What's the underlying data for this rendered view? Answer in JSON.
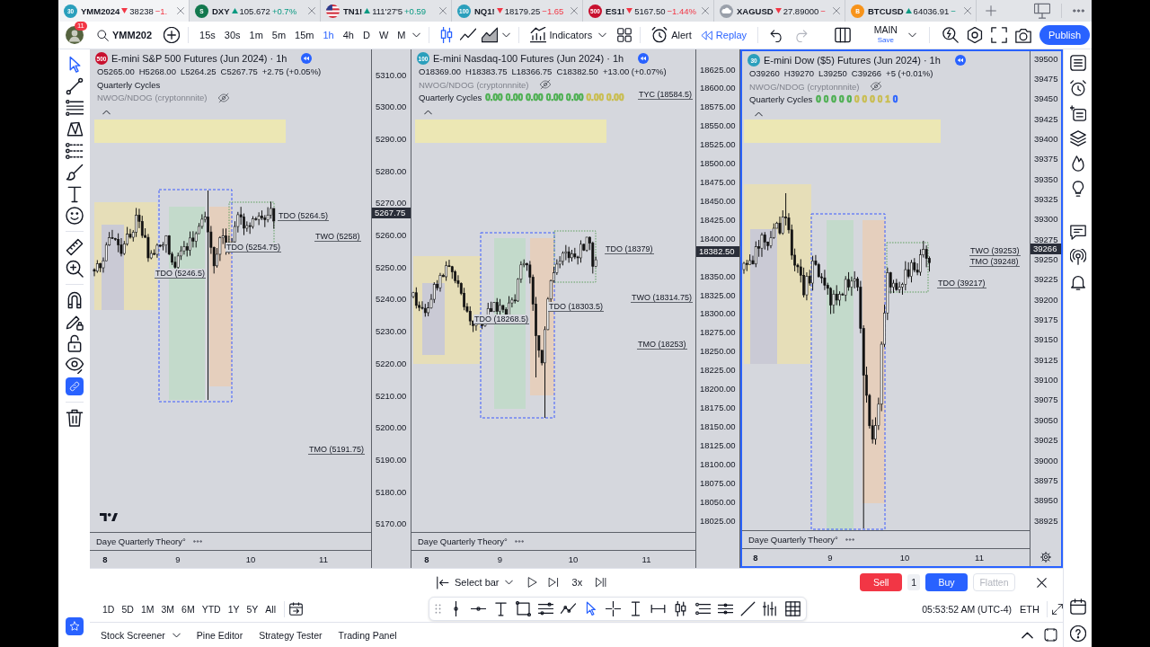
{
  "tabs": [
    {
      "kind": "badge",
      "badge": "30",
      "color": "#2a9fbc",
      "symbol": "YMM2024",
      "rising": false,
      "price": "38238",
      "change": "−1.",
      "selected": true
    },
    {
      "kind": "badge",
      "badge": "S",
      "color": "#12774d",
      "symbol": "DXY",
      "rising": true,
      "price": "105.672",
      "change": "+0.7%",
      "selected": false
    },
    {
      "kind": "flag",
      "symbol": "TN1!",
      "rising": true,
      "price": "111'27'5",
      "change": "+0.59",
      "selected": false
    },
    {
      "kind": "badge",
      "badge": "100",
      "color": "#2a9fbc",
      "symbol": "NQ1!",
      "rising": false,
      "price": "18179.25",
      "change": "−1.65",
      "selected": false
    },
    {
      "kind": "badge",
      "badge": "500",
      "color": "#c8102e",
      "symbol": "ES1!",
      "rising": false,
      "price": "5167.50",
      "change": "−1.44%",
      "selected": false
    },
    {
      "kind": "cloud",
      "symbol": "XAGUSD",
      "rising": false,
      "price": "27.89000",
      "change": "−",
      "selected": false
    },
    {
      "kind": "badge",
      "badge": "B",
      "color": "#f7931a",
      "symbol": "BTCUSD",
      "rising": true,
      "price": "64036.91",
      "change": "−",
      "selected": false
    }
  ],
  "user": {
    "notifications": "11"
  },
  "symbol_search": "YMM202",
  "intervals": [
    {
      "label": "15s",
      "selected": false
    },
    {
      "label": "30s",
      "selected": false
    },
    {
      "label": "1m",
      "selected": false
    },
    {
      "label": "5m",
      "selected": false
    },
    {
      "label": "15m",
      "selected": false
    },
    {
      "label": "1h",
      "selected": true
    },
    {
      "label": "4h",
      "selected": false
    },
    {
      "label": "D",
      "selected": false
    },
    {
      "label": "W",
      "selected": false
    },
    {
      "label": "M",
      "selected": false
    }
  ],
  "chart_types": [
    {
      "kind": "candles",
      "selected": true
    },
    {
      "kind": "line",
      "selected": false
    },
    {
      "kind": "area",
      "selected": false
    }
  ],
  "indicators_button": "Indicators",
  "alert_button": "Alert",
  "replay_button": "Replay",
  "history": [
    {
      "kind": "undo",
      "disabled": false
    },
    {
      "kind": "redo",
      "disabled": true
    }
  ],
  "layout": {
    "name": "MAIN",
    "status": "Save"
  },
  "publish_button": "Publish",
  "left_toolbar": [
    [
      {
        "kind": "cursor",
        "selected": true,
        "on": false
      },
      {
        "kind": "trendline",
        "selected": false,
        "on": false
      },
      {
        "kind": "fib",
        "selected": false,
        "on": false
      },
      {
        "kind": "pattern",
        "selected": false,
        "on": false
      },
      {
        "kind": "projection",
        "selected": false,
        "on": false
      },
      {
        "kind": "brush",
        "selected": false,
        "on": false
      },
      {
        "kind": "text",
        "selected": false,
        "on": false
      },
      {
        "kind": "emoji",
        "selected": false,
        "on": false
      }
    ],
    [
      {
        "kind": "ruler",
        "selected": false,
        "on": false
      },
      {
        "kind": "zoom",
        "selected": false,
        "on": false
      }
    ],
    [
      {
        "kind": "magnet",
        "selected": false,
        "on": false
      },
      {
        "kind": "pencillock",
        "selected": false,
        "on": false
      },
      {
        "kind": "lock",
        "selected": false,
        "on": false
      },
      {
        "kind": "eye",
        "selected": false,
        "on": false
      },
      {
        "kind": "link",
        "selected": false,
        "on": true
      }
    ],
    [
      {
        "kind": "trash",
        "selected": false,
        "on": false
      }
    ]
  ],
  "favorites": {
    "on": true
  },
  "panels": [
    {
      "badge": "500",
      "color": "#c8102e",
      "title": "E-mini S&P 500 Futures (Jun 2024) · 1h",
      "selected": false,
      "ohlc": {
        "open": "O5265.00",
        "high": "H5268.00",
        "low": "L5264.25",
        "close": "C5267.75",
        "change": "+2.75 (+0.05%)"
      },
      "studies": [
        {
          "name": "Quarterly Cycles",
          "hidden": false
        },
        {
          "name": "NWOG/NDOG (cryptonnnite)",
          "hidden": true
        }
      ],
      "labels": [
        "TDO (5264.5)",
        "TDO (5254.75)",
        "TWO (5258)",
        "TDO (5246.5)",
        "TMO (5191.75)"
      ],
      "logo": true,
      "price_axis": [
        "5310.00",
        "5300.00",
        "5290.00",
        "5280.00",
        "5270.00",
        "5260.00",
        "5250.00",
        "5240.00",
        "5230.00",
        "5220.00",
        "5210.00",
        "5200.00",
        "5190.00",
        "5180.00",
        "5170.00"
      ],
      "last_price": "5267.75",
      "pane": "Daye Quarterly Theory°",
      "time_axis": [
        "8",
        "9",
        "10",
        "11"
      ]
    },
    {
      "badge": "100",
      "color": "#2a9fbc",
      "title": "E-mini Nasdaq-100 Futures (Jun 2024) · 1h",
      "selected": false,
      "ohlc": {
        "open": "O18369.00",
        "high": "H18383.75",
        "low": "L18366.75",
        "close": "C18382.50",
        "change": "+13.00 (+0.07%)"
      },
      "studies": [
        {
          "name": "NWOG/NDOG (cryptonnnite)",
          "hidden": true
        },
        {
          "name": "Quarterly Cycles",
          "hidden": false,
          "values": [
            {
              "text": "0.00",
              "color": "#4caf50"
            },
            {
              "text": "0.00",
              "color": "#4caf50"
            },
            {
              "text": "0.00",
              "color": "#4caf50"
            },
            {
              "text": "0.00",
              "color": "#4caf50"
            },
            {
              "text": "0.00",
              "color": "#4caf50"
            },
            {
              "text": "0.00",
              "color": "#c9bd4f"
            },
            {
              "text": "0.00",
              "color": "#c9bd4f"
            }
          ]
        }
      ],
      "labels": [
        "TYC (18584.5)",
        "TDO (18379)",
        "TWO (18314.75)",
        "TDO (18303.5)",
        "TDO (18268.5)",
        "TMO (18253)"
      ],
      "logo": false,
      "price_axis": [
        "18625.00",
        "18600.00",
        "18575.00",
        "18550.00",
        "18525.00",
        "18500.00",
        "18475.00",
        "18450.00",
        "18425.00",
        "18400.00",
        "18350.00",
        "18325.00",
        "18300.00",
        "18275.00",
        "18250.00",
        "18225.00",
        "18200.00",
        "18175.00",
        "18150.00",
        "18125.00",
        "18100.00",
        "18075.00",
        "18050.00",
        "18025.00"
      ],
      "last_price": "18382.50",
      "pane": "Daye Quarterly Theory°",
      "time_axis": [
        "8",
        "9",
        "10",
        "11"
      ]
    },
    {
      "badge": "30",
      "color": "#2a9fbc",
      "title": "E-mini Dow ($5) Futures (Jun 2024) · 1h",
      "selected": true,
      "ohlc": {
        "open": "O39260",
        "high": "H39270",
        "low": "L39250",
        "close": "C39266",
        "change": "+5 (+0.01%)"
      },
      "studies": [
        {
          "name": "NWOG/NDOG (cryptonnnite)",
          "hidden": true
        },
        {
          "name": "Quarterly Cycles",
          "hidden": false,
          "values": [
            {
              "text": "0",
              "color": "#4caf50"
            },
            {
              "text": "0",
              "color": "#4caf50"
            },
            {
              "text": "0",
              "color": "#4caf50"
            },
            {
              "text": "0",
              "color": "#4caf50"
            },
            {
              "text": "0",
              "color": "#4caf50"
            },
            {
              "text": "0",
              "color": "#c9bd4f"
            },
            {
              "text": "0",
              "color": "#c9bd4f"
            },
            {
              "text": "0",
              "color": "#c9bd4f"
            },
            {
              "text": "0",
              "color": "#c9bd4f"
            },
            {
              "text": "1",
              "color": "#c9bd4f"
            },
            {
              "text": "0",
              "color": "#2962ff"
            }
          ]
        }
      ],
      "labels": [
        "TWO (39253)",
        "TMO (39248)",
        "TDO (39217)"
      ],
      "logo": false,
      "price_axis": [
        "39500",
        "39475",
        "39450",
        "39425",
        "39400",
        "39375",
        "39350",
        "39325",
        "39300",
        "39275",
        "39250",
        "39225",
        "39200",
        "39175",
        "39150",
        "39125",
        "39100",
        "39075",
        "39050",
        "39025",
        "39000",
        "38975",
        "38950",
        "38925"
      ],
      "last_price": "39266",
      "pane": "Daye Quarterly Theory°",
      "time_axis": [
        "8",
        "9",
        "10",
        "11"
      ]
    }
  ],
  "replay": {
    "select_bar": "Select bar",
    "speed": "3x",
    "sell": "Sell",
    "quantity": "1",
    "buy": "Buy",
    "flatten": {
      "label": "Flatten",
      "disabled": true
    }
  },
  "ranges": [
    "1D",
    "5D",
    "1M",
    "3M",
    "6M",
    "YTD",
    "1Y",
    "5Y",
    "All"
  ],
  "drawing_toolbar": [
    {
      "kind": "vline",
      "selected": false
    },
    {
      "kind": "hline",
      "selected": false
    },
    {
      "kind": "text",
      "selected": false
    },
    {
      "kind": "rect",
      "selected": false
    },
    {
      "kind": "channel",
      "selected": false
    },
    {
      "kind": "path",
      "selected": false
    },
    {
      "kind": "cursor",
      "selected": true
    },
    {
      "kind": "crosshair",
      "selected": false
    },
    {
      "kind": "vmeasure",
      "selected": false
    },
    {
      "kind": "hmeasure",
      "selected": false
    },
    {
      "kind": "candles",
      "selected": false
    },
    {
      "kind": "fibdots",
      "selected": false
    },
    {
      "kind": "levels",
      "selected": false
    },
    {
      "kind": "diagonal",
      "selected": false
    },
    {
      "kind": "bars",
      "selected": false
    },
    {
      "kind": "table",
      "selected": false
    }
  ],
  "clock": "05:53:52 AM (UTC-4)",
  "session": "ETH",
  "bottom_tabs": [
    {
      "label": "Stock Screener",
      "dropdown": true
    },
    {
      "label": "Pine Editor",
      "dropdown": false
    },
    {
      "label": "Strategy Tester",
      "dropdown": false
    },
    {
      "label": "Trading Panel",
      "dropdown": false
    }
  ]
}
